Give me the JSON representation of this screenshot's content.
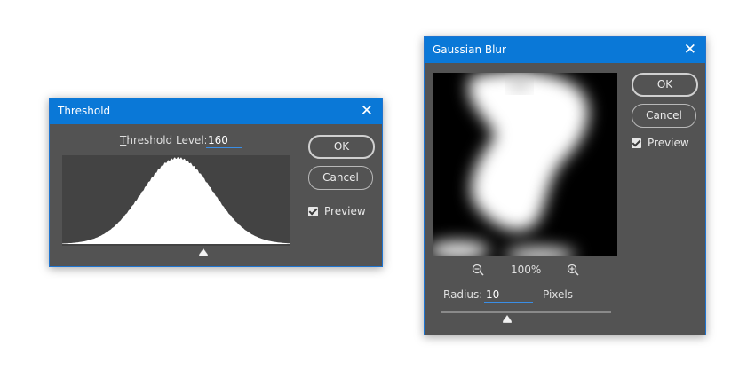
{
  "threshold": {
    "title": "Threshold",
    "level_label_u": "T",
    "level_label_rest": "hreshold Level:",
    "level_value": "160",
    "ok_label": "OK",
    "cancel_label": "Cancel",
    "preview_u": "P",
    "preview_rest": "review",
    "preview_checked": true,
    "histogram_color": "#ffffff",
    "slider_level": 160
  },
  "gaussian": {
    "title": "Gaussian Blur",
    "ok_label": "OK",
    "cancel_label": "Cancel",
    "preview_label": "Preview",
    "preview_checked": true,
    "zoom": "100%",
    "radius_label": "Radius:",
    "radius_value": "10",
    "unit": "Pixels"
  },
  "colors": {
    "titlebar": "#0a78d7",
    "dialog_bg": "#535353",
    "accent": "#3a8ee6"
  },
  "icons": [
    "close-icon",
    "zoom-out-icon",
    "zoom-in-icon",
    "checkbox-checked-icon",
    "slider-triangle-icon"
  ]
}
